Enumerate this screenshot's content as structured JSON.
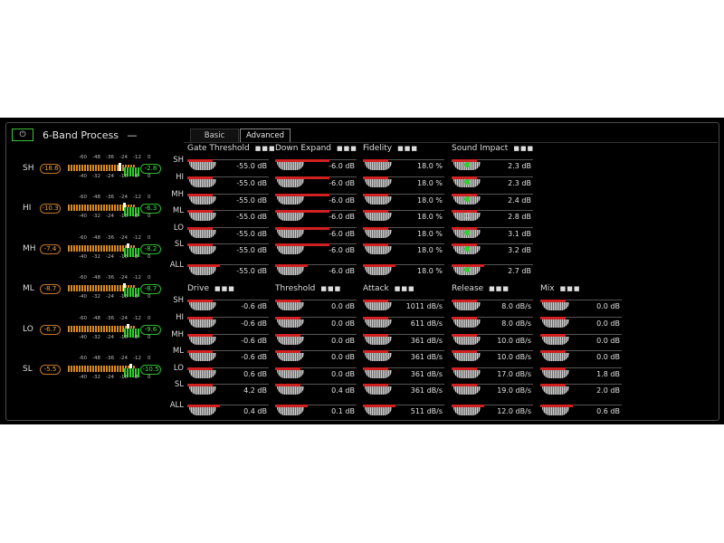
{
  "header": {
    "power_icon": "power-icon",
    "power_glyph": "⏻",
    "title": "6-Band Process",
    "title_suffix": "—",
    "tabs": [
      "Basic",
      "Advanced"
    ],
    "active_tab": "Advanced"
  },
  "meters": {
    "scale_top": [
      "-60",
      "-48",
      "-36",
      "-24",
      "-12",
      "0"
    ],
    "scale_bottom": [
      "-40",
      "-32",
      "-24",
      "-16",
      "-8",
      "0"
    ],
    "bands": [
      {
        "label": "SH",
        "input": "-18.6",
        "output": "-2.8"
      },
      {
        "label": "HI",
        "input": "-10.3",
        "output": "-6.3"
      },
      {
        "label": "MH",
        "input": "-7.4",
        "output": "-8.2"
      },
      {
        "label": "ML",
        "input": "-8.7",
        "output": "-8.7"
      },
      {
        "label": "LO",
        "input": "-6.7",
        "output": "-9.6"
      },
      {
        "label": "SL",
        "input": "-5.5",
        "output": "-10.5"
      }
    ]
  },
  "row_labels": [
    "SH",
    "HI",
    "MH",
    "ML",
    "LO",
    "SL",
    "ALL"
  ],
  "top_section": [
    {
      "name": "Gate Threshold",
      "values": [
        "-55.0 dB",
        "-55.0 dB",
        "-55.0 dB",
        "-55.0 dB",
        "-55.0 dB",
        "-55.0 dB",
        "-55.0 dB"
      ]
    },
    {
      "name": "Down Expand",
      "values": [
        "-6.0 dB",
        "-6.0 dB",
        "-6.0 dB",
        "-6.0 dB",
        "-6.0 dB",
        "-6.0 dB",
        "-6.0 dB"
      ]
    },
    {
      "name": "Fidelity",
      "values": [
        "18.0 %",
        "18.0 %",
        "18.0 %",
        "18.0 %",
        "18.0 %",
        "18.0 %",
        "18.0 %"
      ]
    },
    {
      "name": "Sound Impact",
      "values": [
        "2.3 dB",
        "2.3 dB",
        "2.4 dB",
        "2.8 dB",
        "3.1 dB",
        "3.2 dB",
        "2.7 dB"
      ]
    }
  ],
  "bottom_section": [
    {
      "name": "Drive",
      "values": [
        "-0.6 dB",
        "-0.6 dB",
        "-0.6 dB",
        "-0.6 dB",
        "0.6 dB",
        "4.2 dB",
        "0.4 dB"
      ]
    },
    {
      "name": "Threshold",
      "values": [
        "0.0 dB",
        "0.0 dB",
        "0.0 dB",
        "0.0 dB",
        "0.0 dB",
        "0.4 dB",
        "0.1 dB"
      ]
    },
    {
      "name": "Attack",
      "values": [
        "1011 dB/s",
        "611 dB/s",
        "361 dB/s",
        "361 dB/s",
        "361 dB/s",
        "361 dB/s",
        "511 dB/s"
      ]
    },
    {
      "name": "Release",
      "values": [
        "8.0 dB/s",
        "8.0 dB/s",
        "10.0 dB/s",
        "10.0 dB/s",
        "17.0 dB/s",
        "19.0 dB/s",
        "12.0 dB/s"
      ]
    },
    {
      "name": "Mix",
      "values": [
        "0.0 dB",
        "0.0 dB",
        "0.0 dB",
        "0.0 dB",
        "1.8 dB",
        "2.0 dB",
        "0.6 dB"
      ]
    }
  ],
  "colors": {
    "accent_red": "#d02020",
    "meter_orange": "#d88a28",
    "meter_green": "#30d030"
  }
}
